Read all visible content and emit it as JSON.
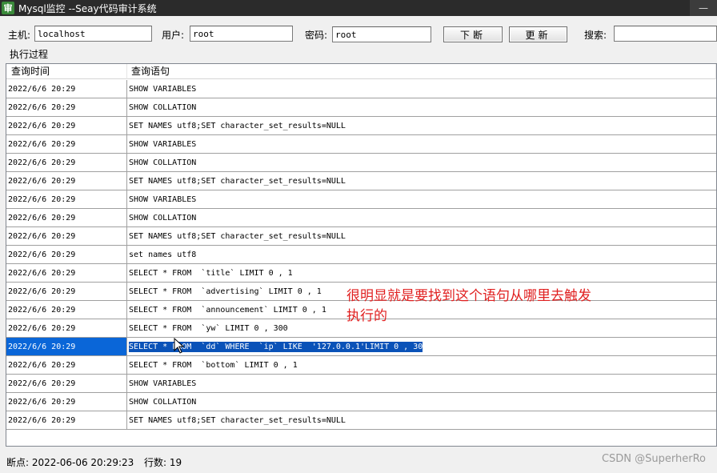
{
  "window": {
    "title": "Mysql监控 --Seay代码审计系统",
    "icon_text": "审",
    "minimize_glyph": "—"
  },
  "toolbar": {
    "host_label": "主机:",
    "host_value": "localhost",
    "user_label": "用户:",
    "user_value": "root",
    "password_label": "密码:",
    "password_value": "root",
    "break_button": "下断",
    "refresh_button": "更新",
    "search_label": "搜索:",
    "search_value": ""
  },
  "group_label": "执行过程",
  "table": {
    "columns": [
      "查询时间",
      "查询语句"
    ],
    "rows": [
      {
        "time": "2022/6/6 20:29",
        "query": "SHOW VARIABLES"
      },
      {
        "time": "2022/6/6 20:29",
        "query": "SHOW COLLATION"
      },
      {
        "time": "2022/6/6 20:29",
        "query": "SET NAMES utf8;SET character_set_results=NULL"
      },
      {
        "time": "2022/6/6 20:29",
        "query": "SHOW VARIABLES"
      },
      {
        "time": "2022/6/6 20:29",
        "query": "SHOW COLLATION"
      },
      {
        "time": "2022/6/6 20:29",
        "query": "SET NAMES utf8;SET character_set_results=NULL"
      },
      {
        "time": "2022/6/6 20:29",
        "query": "SHOW VARIABLES"
      },
      {
        "time": "2022/6/6 20:29",
        "query": "SHOW COLLATION"
      },
      {
        "time": "2022/6/6 20:29",
        "query": "SET NAMES utf8;SET character_set_results=NULL"
      },
      {
        "time": "2022/6/6 20:29",
        "query": "set names utf8"
      },
      {
        "time": "2022/6/6 20:29",
        "query": "SELECT * FROM  `title` LIMIT 0 , 1"
      },
      {
        "time": "2022/6/6 20:29",
        "query": "SELECT * FROM  `advertising` LIMIT 0 , 1"
      },
      {
        "time": "2022/6/6 20:29",
        "query": "SELECT * FROM  `announcement` LIMIT 0 , 1"
      },
      {
        "time": "2022/6/6 20:29",
        "query": "SELECT * FROM  `yw` LIMIT 0 , 300"
      },
      {
        "time": "2022/6/6 20:29",
        "query": "SELECT * FROM  `dd` WHERE  `ip` LIKE  '127.0.0.1'LIMIT 0 , 30"
      },
      {
        "time": "2022/6/6 20:29",
        "query": "SELECT * FROM  `bottom` LIMIT 0 , 1"
      },
      {
        "time": "2022/6/6 20:29",
        "query": "SHOW VARIABLES"
      },
      {
        "time": "2022/6/6 20:29",
        "query": "SHOW COLLATION"
      },
      {
        "time": "2022/6/6 20:29",
        "query": "SET NAMES utf8;SET character_set_results=NULL"
      }
    ],
    "selected_row": 14
  },
  "annotation": {
    "line1": "很明显就是要找到这个语句从哪里去触发",
    "line2": "执行的"
  },
  "status": {
    "breakpoint": "断点: 2022-06-06 20:29:23",
    "row_count": "行数: 19"
  },
  "watermark": "CSDN @SuperherRo",
  "colors": {
    "selection": "#0a66d8",
    "annotation": "#e02020"
  }
}
